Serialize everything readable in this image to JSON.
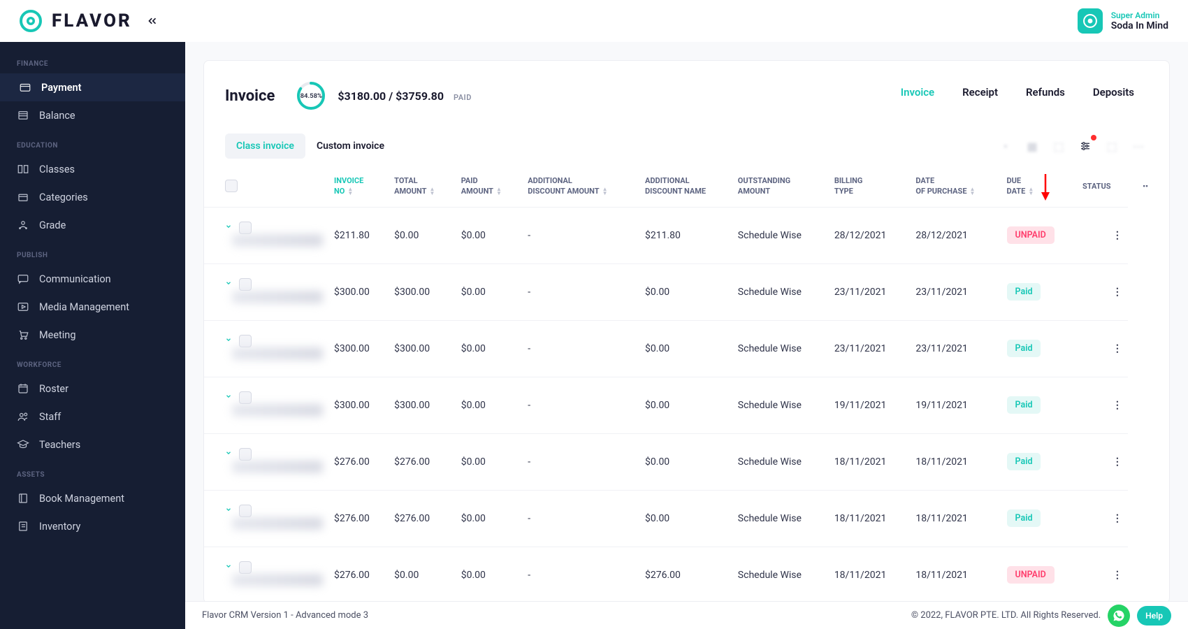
{
  "brand": {
    "name": "FLAVOR"
  },
  "profile": {
    "role": "Super Admin",
    "name": "Soda In Mind"
  },
  "sidebar": {
    "sections": [
      {
        "label": "FINANCE",
        "items": [
          {
            "label": "Payment",
            "active": true,
            "icon": "card"
          },
          {
            "label": "Balance",
            "icon": "balance"
          }
        ]
      },
      {
        "label": "EDUCATION",
        "items": [
          {
            "label": "Classes",
            "icon": "book-open"
          },
          {
            "label": "Categories",
            "icon": "box"
          },
          {
            "label": "Grade",
            "icon": "grad"
          }
        ]
      },
      {
        "label": "PUBLISH",
        "items": [
          {
            "label": "Communication",
            "icon": "chat"
          },
          {
            "label": "Media Management",
            "icon": "media"
          },
          {
            "label": "Meeting",
            "icon": "cart"
          }
        ]
      },
      {
        "label": "WORKFORCE",
        "items": [
          {
            "label": "Roster",
            "icon": "calendar"
          },
          {
            "label": "Staff",
            "icon": "users"
          },
          {
            "label": "Teachers",
            "icon": "cap"
          }
        ]
      },
      {
        "label": "ASSETS",
        "items": [
          {
            "label": "Book Management",
            "icon": "book"
          },
          {
            "label": "Inventory",
            "icon": "inv"
          }
        ]
      }
    ]
  },
  "page": {
    "title": "Invoice",
    "progress_percent": "84.58%",
    "paid_amount": "$3180.00",
    "total_amount": "$3759.80",
    "paid_label": "PAID",
    "tabs": [
      {
        "label": "Invoice",
        "active": true
      },
      {
        "label": "Receipt"
      },
      {
        "label": "Refunds"
      },
      {
        "label": "Deposits"
      }
    ],
    "subtabs": [
      {
        "label": "Class invoice",
        "active": true
      },
      {
        "label": "Custom invoice"
      }
    ]
  },
  "table": {
    "columns": [
      "INVOICE NO",
      "TOTAL AMOUNT",
      "PAID AMOUNT",
      "ADDITIONAL DISCOUNT AMOUNT",
      "ADDITIONAL DISCOUNT NAME",
      "OUTSTANDING AMOUNT",
      "BILLING TYPE",
      "DATE OF PURCHASE",
      "DUE DATE",
      "STATUS"
    ],
    "rows": [
      {
        "total": "$211.80",
        "paid": "$0.00",
        "disc": "$0.00",
        "dname": "-",
        "out": "$211.80",
        "btype": "Schedule Wise",
        "dop": "28/12/2021",
        "due": "28/12/2021",
        "status": "UNPAID"
      },
      {
        "total": "$300.00",
        "paid": "$300.00",
        "disc": "$0.00",
        "dname": "-",
        "out": "$0.00",
        "btype": "Schedule Wise",
        "dop": "23/11/2021",
        "due": "23/11/2021",
        "status": "Paid"
      },
      {
        "total": "$300.00",
        "paid": "$300.00",
        "disc": "$0.00",
        "dname": "-",
        "out": "$0.00",
        "btype": "Schedule Wise",
        "dop": "23/11/2021",
        "due": "23/11/2021",
        "status": "Paid"
      },
      {
        "total": "$300.00",
        "paid": "$300.00",
        "disc": "$0.00",
        "dname": "-",
        "out": "$0.00",
        "btype": "Schedule Wise",
        "dop": "19/11/2021",
        "due": "19/11/2021",
        "status": "Paid"
      },
      {
        "total": "$276.00",
        "paid": "$276.00",
        "disc": "$0.00",
        "dname": "-",
        "out": "$0.00",
        "btype": "Schedule Wise",
        "dop": "18/11/2021",
        "due": "18/11/2021",
        "status": "Paid"
      },
      {
        "total": "$276.00",
        "paid": "$276.00",
        "disc": "$0.00",
        "dname": "-",
        "out": "$0.00",
        "btype": "Schedule Wise",
        "dop": "18/11/2021",
        "due": "18/11/2021",
        "status": "Paid"
      },
      {
        "total": "$276.00",
        "paid": "$0.00",
        "disc": "$0.00",
        "dname": "-",
        "out": "$276.00",
        "btype": "Schedule Wise",
        "dop": "18/11/2021",
        "due": "18/11/2021",
        "status": "UNPAID"
      }
    ]
  },
  "footer": {
    "left": "Flavor CRM Version 1 - Advanced mode 3",
    "right": "© 2022, FLAVOR PTE. LTD. All Rights Reserved.",
    "help": "Help"
  }
}
